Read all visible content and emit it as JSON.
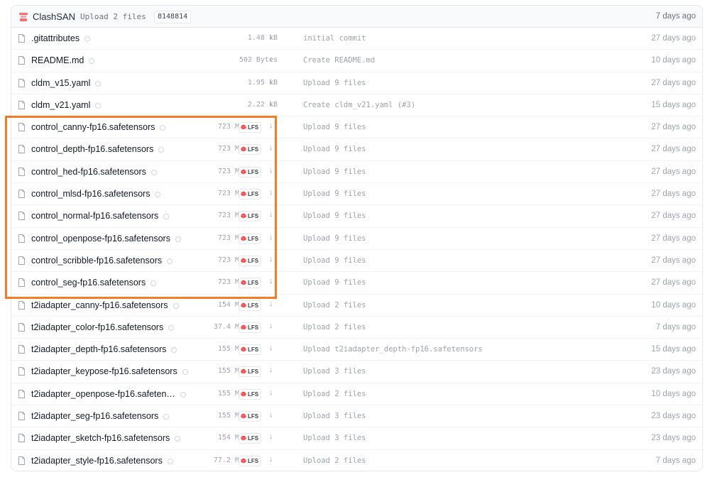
{
  "header": {
    "user": "ClashSAN",
    "commit_message": "Upload 2 files",
    "commit_hash": "8148814",
    "date": "7 days ago"
  },
  "files": [
    {
      "name": ".gitattributes",
      "size": "1.48 kB",
      "lfs": false,
      "commit": "initial commit",
      "date": "27 days ago"
    },
    {
      "name": "README.md",
      "size": "502 Bytes",
      "lfs": false,
      "commit": "Create README.md",
      "date": "10 days ago"
    },
    {
      "name": "cldm_v15.yaml",
      "size": "1.95 kB",
      "lfs": false,
      "commit": "Upload 9 files",
      "date": "27 days ago"
    },
    {
      "name": "cldm_v21.yaml",
      "size": "2.22 kB",
      "lfs": false,
      "commit": "Create cldm_v21.yaml (#3)",
      "date": "15 days ago"
    },
    {
      "name": "control_canny-fp16.safetensors",
      "size": "723 MB",
      "lfs": true,
      "commit": "Upload 9 files",
      "date": "27 days ago"
    },
    {
      "name": "control_depth-fp16.safetensors",
      "size": "723 MB",
      "lfs": true,
      "commit": "Upload 9 files",
      "date": "27 days ago"
    },
    {
      "name": "control_hed-fp16.safetensors",
      "size": "723 MB",
      "lfs": true,
      "commit": "Upload 9 files",
      "date": "27 days ago"
    },
    {
      "name": "control_mlsd-fp16.safetensors",
      "size": "723 MB",
      "lfs": true,
      "commit": "Upload 9 files",
      "date": "27 days ago"
    },
    {
      "name": "control_normal-fp16.safetensors",
      "size": "723 MB",
      "lfs": true,
      "commit": "Upload 9 files",
      "date": "27 days ago"
    },
    {
      "name": "control_openpose-fp16.safetensors",
      "size": "723 MB",
      "lfs": true,
      "commit": "Upload 9 files",
      "date": "27 days ago"
    },
    {
      "name": "control_scribble-fp16.safetensors",
      "size": "723 MB",
      "lfs": true,
      "commit": "Upload 9 files",
      "date": "27 days ago"
    },
    {
      "name": "control_seg-fp16.safetensors",
      "size": "723 MB",
      "lfs": true,
      "commit": "Upload 9 files",
      "date": "27 days ago"
    },
    {
      "name": "t2iadapter_canny-fp16.safetensors",
      "size": "154 MB",
      "lfs": true,
      "commit": "Upload 2 files",
      "date": "10 days ago"
    },
    {
      "name": "t2iadapter_color-fp16.safetensors",
      "size": "37.4 MB",
      "lfs": true,
      "commit": "Upload 2 files",
      "date": "7 days ago"
    },
    {
      "name": "t2iadapter_depth-fp16.safetensors",
      "size": "155 MB",
      "lfs": true,
      "commit": "Upload t2iadapter_depth-fp16.safetensors",
      "date": "15 days ago"
    },
    {
      "name": "t2iadapter_keypose-fp16.safetensors",
      "size": "155 MB",
      "lfs": true,
      "commit": "Upload 3 files",
      "date": "23 days ago"
    },
    {
      "name": "t2iadapter_openpose-fp16.safeten…",
      "size": "155 MB",
      "lfs": true,
      "commit": "Upload 2 files",
      "date": "10 days ago"
    },
    {
      "name": "t2iadapter_seg-fp16.safetensors",
      "size": "155 MB",
      "lfs": true,
      "commit": "Upload 3 files",
      "date": "23 days ago"
    },
    {
      "name": "t2iadapter_sketch-fp16.safetensors",
      "size": "154 MB",
      "lfs": true,
      "commit": "Upload 3 files",
      "date": "23 days ago"
    },
    {
      "name": "t2iadapter_style-fp16.safetensors",
      "size": "77.2 MB",
      "lfs": true,
      "commit": "Upload 2 files",
      "date": "7 days ago"
    }
  ],
  "lfs_label": "LFS",
  "download_glyph": "↓",
  "colors": {
    "highlight": "#f27d26",
    "lfs_icon": "#ef4444"
  }
}
